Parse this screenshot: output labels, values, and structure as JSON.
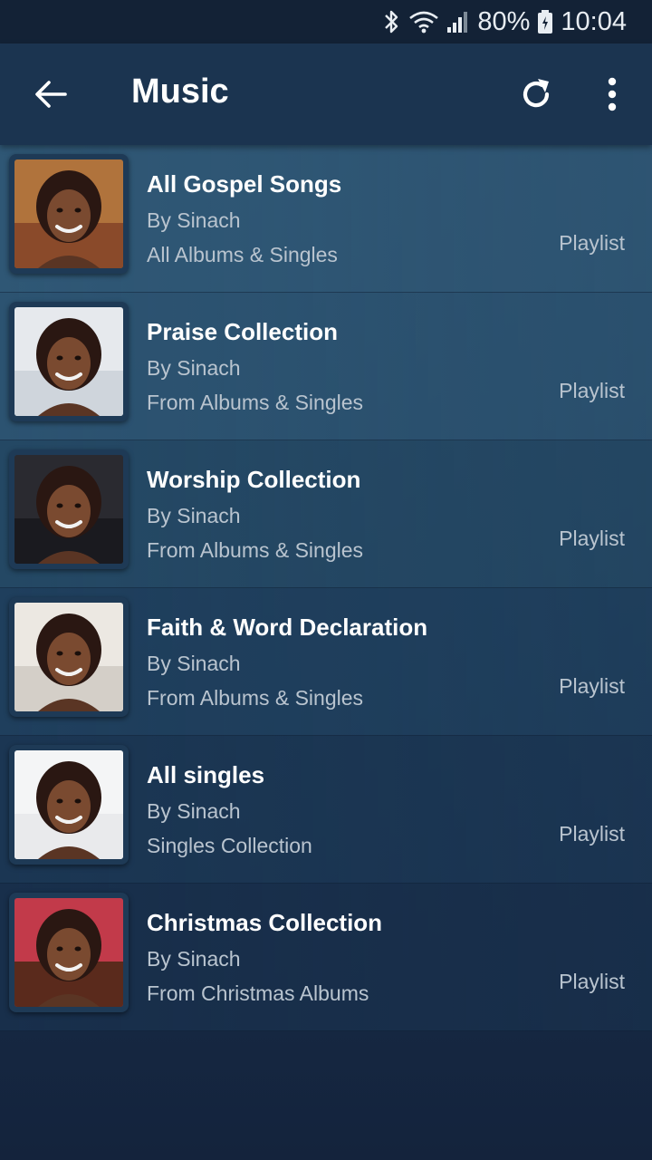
{
  "status_bar": {
    "battery": "80%",
    "time": "10:04",
    "icons": [
      "bluetooth-icon",
      "wifi-icon",
      "signal-icon",
      "battery-icon"
    ]
  },
  "header": {
    "title": "Music",
    "back_icon": "arrow-left-icon",
    "refresh_icon": "refresh-icon",
    "more_icon": "more-vert-icon"
  },
  "playlists": [
    {
      "name": "All Gospel Songs",
      "by": "By Sinach",
      "subtitle": "All Albums & Singles",
      "type": "Playlist",
      "bg": "#2f5775",
      "thumb_bg": "#8a4a2a",
      "thumb_top": "#b0733c"
    },
    {
      "name": "Praise Collection",
      "by": "By Sinach",
      "subtitle": "From Albums & Singles",
      "type": "Playlist",
      "bg": "#2c5371",
      "thumb_bg": "#cfd5dc",
      "thumb_top": "#e6e9ed"
    },
    {
      "name": "Worship Collection",
      "by": "By Sinach",
      "subtitle": "From Albums & Singles",
      "type": "Playlist",
      "bg": "#244864",
      "thumb_bg": "#1a1a1f",
      "thumb_top": "#2a2a30"
    },
    {
      "name": "Faith & Word Declaration",
      "by": "By Sinach",
      "subtitle": "From Albums & Singles",
      "type": "Playlist",
      "bg": "#1f3f5d",
      "thumb_bg": "#d4cfc8",
      "thumb_top": "#ece8e2"
    },
    {
      "name": "All singles",
      "by": "By Sinach",
      "subtitle": "Singles Collection",
      "type": "Playlist",
      "bg": "#1b3653",
      "thumb_bg": "#e9eaec",
      "thumb_top": "#f4f5f6"
    },
    {
      "name": "Christmas Collection",
      "by": "By Sinach",
      "subtitle": "From Christmas Albums",
      "type": "Playlist",
      "bg": "#182f4b",
      "thumb_bg": "#5a2a1c",
      "thumb_top": "#c23a4a"
    }
  ]
}
